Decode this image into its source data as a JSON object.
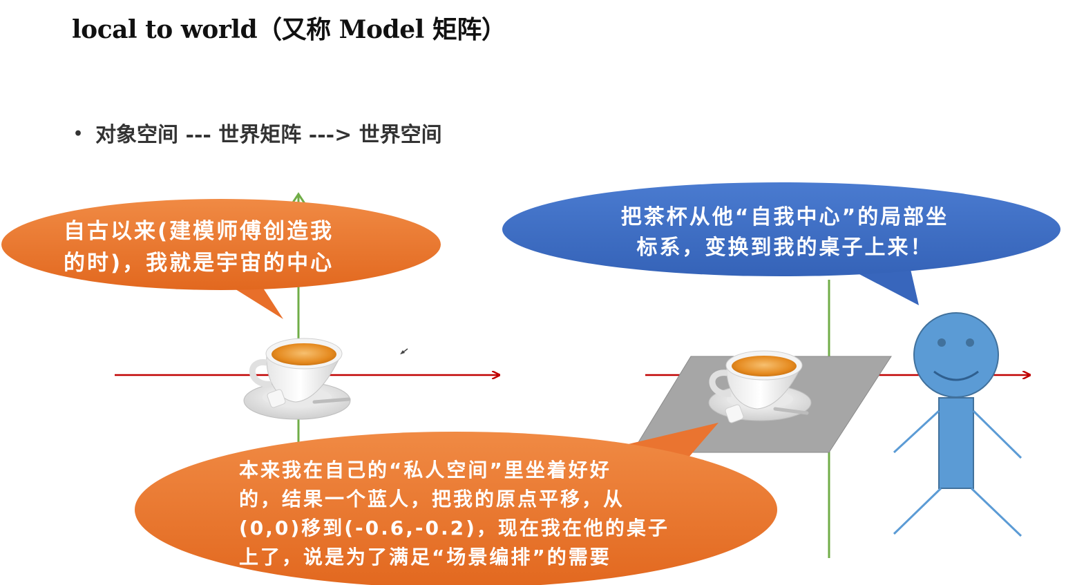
{
  "slide": {
    "title": "local to world（又称 Model 矩阵）",
    "bullet": "对象空间 --- 世界矩阵 ---> 世界空间"
  },
  "bubbles": {
    "left": "自古以来(建模师傅创造我\n的时)，我就是宇宙的中心",
    "top": "把茶杯从他“自我中心”的局部坐\n标系，变换到我的桌子上来！",
    "bottom": "本来我在自己的“私人空间”里坐着好好\n的，结果一个蓝人，把我的原点平移，从\n(0,0)移到(-0.6,-0.2)，现在我在他的桌子\n上了，说是为了满足“场景编排”的需要"
  },
  "colors": {
    "orange_bubble": "#ea7430",
    "blue_bubble": "#3f6fc6",
    "x_axis": "#c00000",
    "y_axis": "#70ad47",
    "table": "#a6a6a6",
    "stick_figure": "#5b9bd5",
    "tea": "#f0a030"
  },
  "icons": [
    "teacup-icon",
    "teacup-on-table-icon",
    "stick-figure-icon",
    "cursor-icon"
  ]
}
